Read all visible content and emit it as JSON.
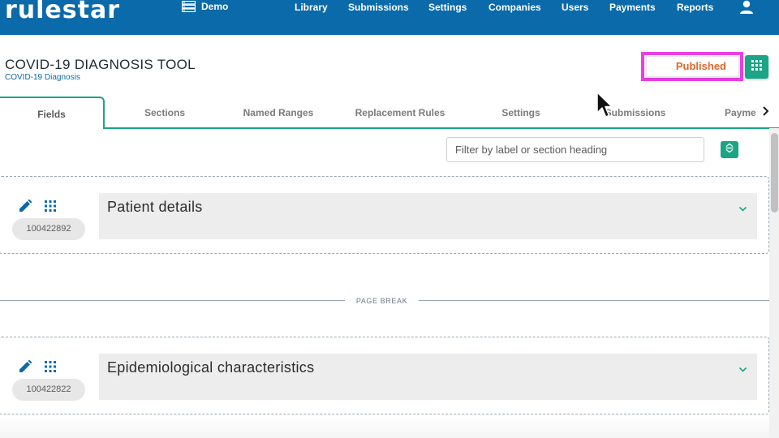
{
  "nav": {
    "logo": "rulestar",
    "workspace": "Demo",
    "items": [
      "Library",
      "Submissions",
      "Settings",
      "Companies",
      "Users",
      "Payments",
      "Reports"
    ]
  },
  "header": {
    "title": "COVID-19 DIAGNOSIS TOOL",
    "subtitle": "COVID-19 Diagnosis",
    "status": "Published"
  },
  "tabs": [
    "Fields",
    "Sections",
    "Named Ranges",
    "Replacement Rules",
    "Settings",
    "Submissions",
    "Payme"
  ],
  "filter": {
    "placeholder": "Filter by label or section heading"
  },
  "sections": [
    {
      "id": "100422892",
      "title": "Patient details"
    },
    {
      "id": "100422822",
      "title": "Epidemiological characteristics"
    }
  ],
  "page_break_label": "PAGE BREAK",
  "colors": {
    "nav": "#0b6aa9",
    "accent": "#1aa585",
    "published": "#e3642a",
    "highlight": "#ea3ee6"
  }
}
